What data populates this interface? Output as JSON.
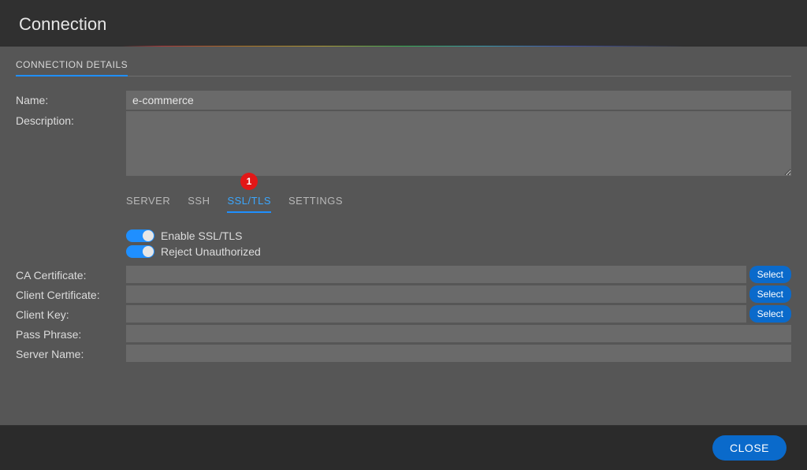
{
  "dialog": {
    "title": "Connection",
    "section_tab": "CONNECTION DETAILS",
    "close_label": "CLOSE"
  },
  "fields": {
    "name_label": "Name:",
    "name_value": "e-commerce",
    "description_label": "Description:",
    "description_value": ""
  },
  "subtabs": {
    "server": "SERVER",
    "ssh": "SSH",
    "ssltls": "SSL/TLS",
    "settings": "SETTINGS",
    "active": "ssltls",
    "badge_on_ssltls": "1"
  },
  "ssl": {
    "enable_label": "Enable SSL/TLS",
    "enable_on": true,
    "reject_label": "Reject Unauthorized",
    "reject_on": true,
    "ca_cert_label": "CA Certificate:",
    "ca_cert_value": "",
    "client_cert_label": "Client Certificate:",
    "client_cert_value": "",
    "client_key_label": "Client Key:",
    "client_key_value": "",
    "pass_phrase_label": "Pass Phrase:",
    "pass_phrase_value": "",
    "server_name_label": "Server Name:",
    "server_name_value": "",
    "select_label": "Select"
  }
}
